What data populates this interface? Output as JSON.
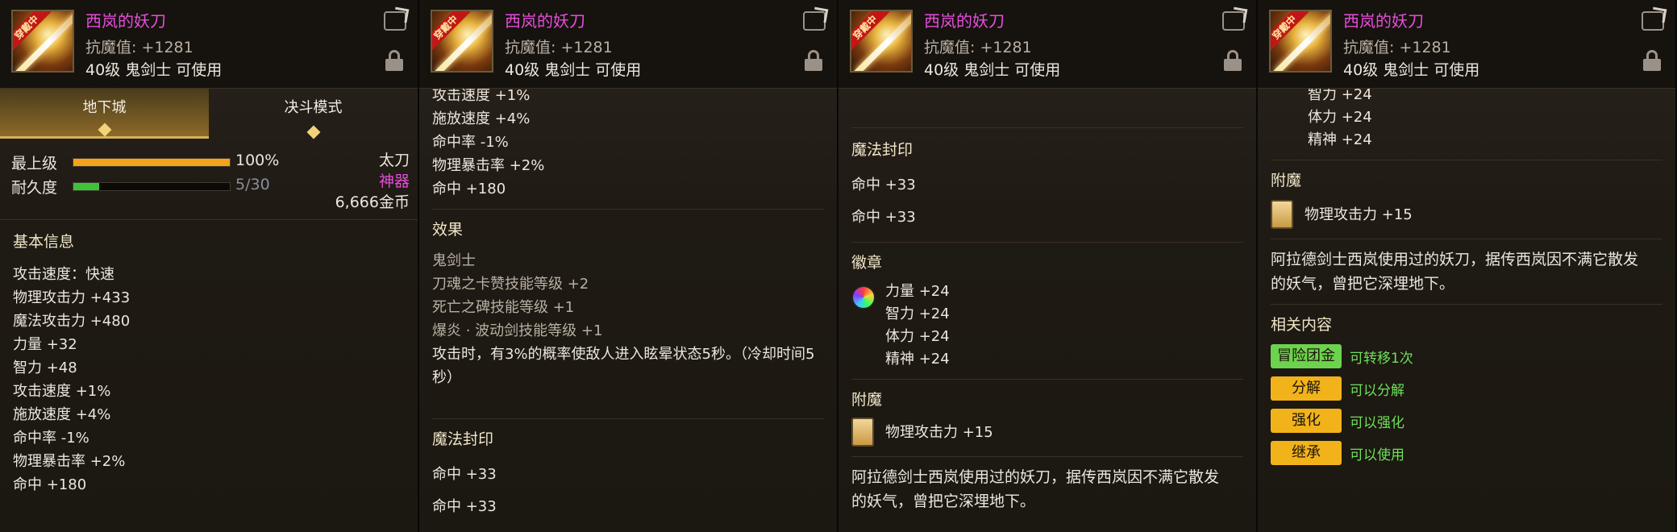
{
  "item": {
    "name": "西岚的妖刀",
    "magic_resist": "抗魔值: +1281",
    "requirement": "40级 鬼剑士 可使用",
    "equipped_badge": "穿戴中"
  },
  "panel1": {
    "tabs": [
      "地下城",
      "决斗模式"
    ],
    "level_label": "最上级",
    "level_value": "100%",
    "level_fill": 1.0,
    "durability_label": "耐久度",
    "durability_value": "5/30",
    "durability_fill": 0.1667,
    "weapon_type": "太刀",
    "rarity": "神器",
    "price": "6,666金币",
    "basic_title": "基本信息",
    "stats": [
      "攻击速度：快速",
      "物理攻击力 +433",
      "魔法攻击力 +480",
      "力量 +32",
      "智力 +48",
      "攻击速度 +1%",
      "施放速度 +4%",
      "命中率 -1%",
      "物理暴击率 +2%",
      "命中 +180"
    ]
  },
  "panel2": {
    "stats_tail": [
      "攻击速度 +1%",
      "施放速度 +4%",
      "命中率 -1%",
      "物理暴击率 +2%",
      "命中 +180"
    ],
    "effect_title": "效果",
    "effects": [
      "鬼剑士",
      "刀魂之卡赞技能等级 +2",
      "死亡之碑技能等级 +1",
      "爆炎 · 波动剑技能等级 +1"
    ],
    "effect_desc_1": "攻击时，有3%的概率使敌人进入眩晕状态5秒。（冷却时间5",
    "effect_desc_2": "秒）",
    "seal_title": "魔法封印",
    "seal_lines": [
      "命中 +33",
      "命中 +33"
    ]
  },
  "panel3": {
    "seal_title": "魔法封印",
    "seal_lines": [
      "命中 +33",
      "命中 +33"
    ],
    "emblem_title": "徽章",
    "emblem_lines": [
      "力量 +24",
      "智力 +24",
      "体力 +24",
      "精神 +24"
    ],
    "enchant_title": "附魔",
    "enchant_value": "物理攻击力 +15",
    "lore_1": "阿拉德剑士西岚使用过的妖刀，据传西岚因不满它散发",
    "lore_2": "的妖气，曾把它深埋地下。"
  },
  "panel4": {
    "emblem_tail": [
      "智力 +24",
      "体力 +24",
      "精神 +24"
    ],
    "enchant_title": "附魔",
    "enchant_value": "物理攻击力 +15",
    "lore_1": "阿拉德剑士西岚使用过的妖刀，据传西岚因不满它散发",
    "lore_2": "的妖气，曾把它深埋地下。",
    "related_title": "相关内容",
    "related": [
      {
        "button": "冒险团金库",
        "text": "可转移1次",
        "style": "green"
      },
      {
        "button": "分解",
        "text": "可以分解",
        "style": "gold"
      },
      {
        "button": "强化",
        "text": "可以强化",
        "style": "gold"
      },
      {
        "button": "继承",
        "text": "可以使用",
        "style": "gold"
      }
    ]
  },
  "colors": {
    "name": "#e64ddb",
    "rarity": "#e64ddb",
    "level_bar": "#f2a51a",
    "durability_bar": "#3fc23a",
    "related_text": "#6ee05a"
  }
}
